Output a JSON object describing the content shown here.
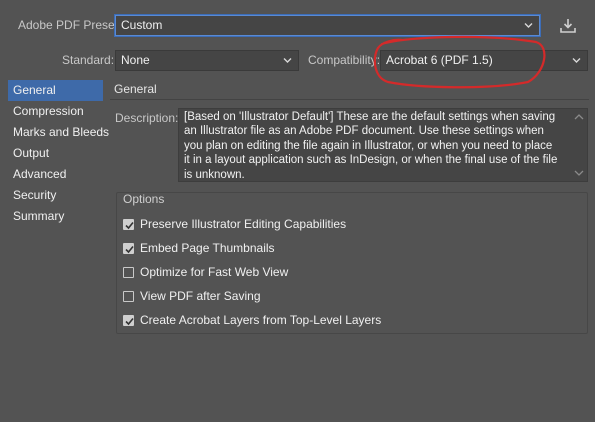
{
  "header": {
    "preset_label": "Adobe PDF Preset:",
    "preset_value": "Custom",
    "standard_label": "Standard:",
    "standard_value": "None",
    "compatibility_label": "Compatibility:",
    "compatibility_value": "Acrobat 6 (PDF 1.5)"
  },
  "sidebar": {
    "items": [
      {
        "label": "General",
        "selected": true
      },
      {
        "label": "Compression"
      },
      {
        "label": "Marks and Bleeds"
      },
      {
        "label": "Output"
      },
      {
        "label": "Advanced"
      },
      {
        "label": "Security"
      },
      {
        "label": "Summary"
      }
    ]
  },
  "main": {
    "section_title": "General",
    "description_label": "Description:",
    "description_lines": [
      "[Based on 'Illustrator Default'] These are the default settings when saving",
      "an Illustrator file as an Adobe PDF document. Use these settings when",
      "you plan on editing the file again in Illustrator, or when you need to place",
      "it in a layout application such as InDesign, or when the final use of the file",
      "is unknown."
    ],
    "options_title": "Options",
    "options": [
      {
        "label": "Preserve Illustrator Editing Capabilities",
        "checked": true
      },
      {
        "label": "Embed Page Thumbnails",
        "checked": true
      },
      {
        "label": "Optimize for Fast Web View",
        "checked": false
      },
      {
        "label": "View PDF after Saving",
        "checked": false
      },
      {
        "label": "Create Acrobat Layers from Top-Level Layers",
        "checked": true
      }
    ]
  },
  "icons": [
    "save-preset-icon",
    "chevron-down-icon",
    "scroll-up-icon",
    "scroll-down-icon",
    "checkmark-icon"
  ],
  "colors": {
    "background": "#535353",
    "field": "#454545",
    "focus_ring": "#5a8ad2",
    "selected_item": "#3e6aa9",
    "annotation_circle": "#d42a2a"
  }
}
